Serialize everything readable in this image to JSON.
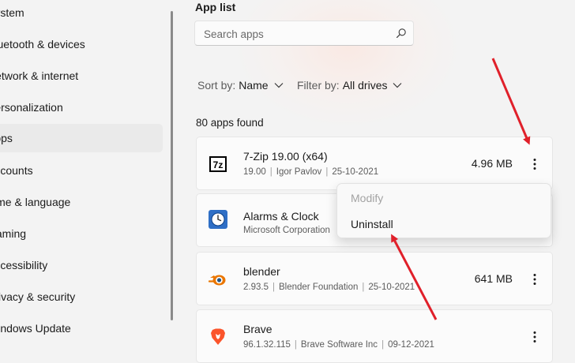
{
  "sidebar": {
    "items": [
      {
        "label": "System"
      },
      {
        "label": "Bluetooth & devices"
      },
      {
        "label": "Network & internet"
      },
      {
        "label": "Personalization"
      },
      {
        "label": "Apps"
      },
      {
        "label": "Accounts"
      },
      {
        "label": "Time & language"
      },
      {
        "label": "Gaming"
      },
      {
        "label": "Accessibility"
      },
      {
        "label": "Privacy & security"
      },
      {
        "label": "Windows Update"
      }
    ],
    "active_index": 4
  },
  "main": {
    "section_title": "App list",
    "search": {
      "placeholder": "Search apps",
      "icon": "search-icon"
    },
    "sort": {
      "label": "Sort by:",
      "value": "Name"
    },
    "filter": {
      "label": "Filter by:",
      "value": "All drives"
    },
    "apps_found": "80 apps found",
    "apps": [
      {
        "name": "7-Zip 19.00 (x64)",
        "version": "19.00",
        "publisher": "Igor Pavlov",
        "date": "25-10-2021",
        "size": "4.96 MB",
        "icon": "7zip-icon"
      },
      {
        "name": "Alarms & Clock",
        "version": "",
        "publisher": "Microsoft Corporation",
        "date": "",
        "size": "",
        "icon": "clock-icon"
      },
      {
        "name": "blender",
        "version": "2.93.5",
        "publisher": "Blender Foundation",
        "date": "25-10-2021",
        "size": "641 MB",
        "icon": "blender-icon"
      },
      {
        "name": "Brave",
        "version": "96.1.32.115",
        "publisher": "Brave Software Inc",
        "date": "09-12-2021",
        "size": "",
        "icon": "brave-icon"
      }
    ]
  },
  "context_menu": {
    "items": [
      {
        "label": "Modify",
        "enabled": false
      },
      {
        "label": "Uninstall",
        "enabled": true
      }
    ]
  },
  "annotation_color": "#e0202a",
  "colors": {
    "background": "#f3f3f3",
    "card": "#fbfbfb",
    "muted_text": "#5c5c5c",
    "disabled_text": "#a3a3a3"
  }
}
